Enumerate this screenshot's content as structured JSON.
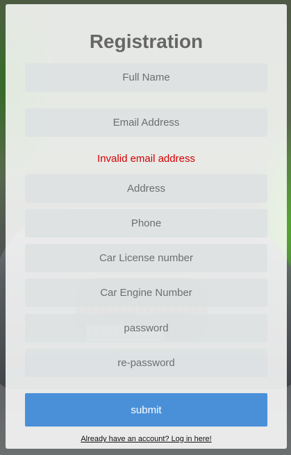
{
  "form": {
    "title": "Registration",
    "fields": [
      {
        "placeholder": "Full Name",
        "value": ""
      },
      {
        "placeholder": "Email Address",
        "value": ""
      },
      {
        "placeholder": "Address",
        "value": ""
      },
      {
        "placeholder": "Phone",
        "value": ""
      },
      {
        "placeholder": "Car License number",
        "value": ""
      },
      {
        "placeholder": "Car Engine Number",
        "value": ""
      },
      {
        "placeholder": "password",
        "value": ""
      },
      {
        "placeholder": "re-password",
        "value": ""
      }
    ],
    "error_message": "Invalid email address",
    "submit_label": "submit",
    "login_link": "Already have an account? Log in here!"
  },
  "colors": {
    "error": "#d40000",
    "submit_bg": "#4a90d9",
    "title": "#666666"
  }
}
